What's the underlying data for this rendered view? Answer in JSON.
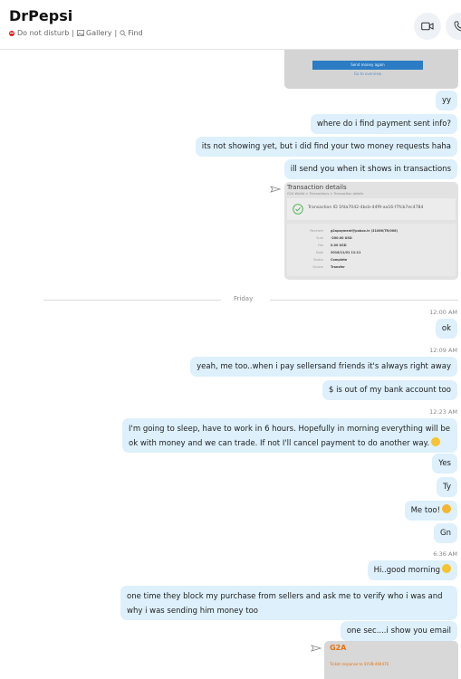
{
  "header": {
    "name": "DrPepsi",
    "status": "Do not disturb",
    "separator": "|",
    "gallery": "Gallery",
    "find": "Find"
  },
  "messages": {
    "send_money_again": "Send money again",
    "go_to_overview": "Go to overview",
    "m1": "yy",
    "m2": "where do i find payment sent info?",
    "m3": "its not showing yet, but i did find your two money requests haha",
    "m4": "ill send you when it shows in transactions",
    "tx_title": "Transaction details",
    "tx_breadcrumb": "G2A Wallet  >  Transactions  >  Transaction details",
    "tx_id": "Transaction ID 1fda7042-4bcb-44f9-aa16-f7fcb7ec4784",
    "tx_rows": [
      {
        "k": "Receiver",
        "v": "g2apayment@pobox.tr (31066/TR/006)"
      },
      {
        "k": "Sum",
        "v": "-200.00 USD"
      },
      {
        "k": "Fee",
        "v": "0.00 USD"
      },
      {
        "k": "Date",
        "v": "2016/11/01 11:11"
      },
      {
        "k": "Status",
        "v": "Complete"
      },
      {
        "k": "Source",
        "v": "Transfer"
      }
    ],
    "day_divider": "Friday",
    "t1": "12:00 AM",
    "m5": "ok",
    "t2": "12:09 AM",
    "m6": "yeah, me too..when i pay sellersand friends it's always right away",
    "m7": "$ is out of my bank account too",
    "t3": "12:23 AM",
    "m8": "I'm going to sleep, have to work in 6 hours. Hopefully in morning everything will be ok with money and we can trade. If not I'll cancel payment to do another way.",
    "m9": "Yes",
    "m10": "Ty",
    "m11": "Me too!",
    "m12": "Gn",
    "t4": "6:36 AM",
    "m13": "Hi..good morning",
    "m14": "one time they block my purchase from sellers and ask me to verify who i was and why i was sending him money too",
    "m15": "one sec....i show you email",
    "g2a_logo": "G2A",
    "ticket_line": "Ticket response to SYUB-494470"
  },
  "colors": {
    "bubble": "#ddf0fb",
    "accent": "#0078d4",
    "dnd": "#e02020"
  }
}
